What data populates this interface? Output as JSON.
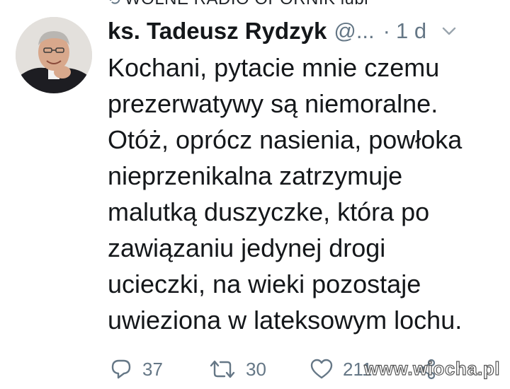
{
  "retweet_context": {
    "text": "WOLNE RADIO OPORNIK lubi"
  },
  "tweet": {
    "display_name": "ks. Tadeusz Rydzyk",
    "handle": "@...",
    "separator": "·",
    "time": "1 d",
    "lines": [
      "Kochani, pytacie mnie czemu",
      "prezerwatywy są niemoralne.",
      "Otóż, oprócz nasienia, powłoka",
      "nieprzenikalna zatrzymuje",
      "malutką duszyczke, która po",
      "zawiązaniu jedynej drogi",
      "ucieczki, na wieki pozostaje",
      "uwieziona w lateksowym lochu."
    ]
  },
  "actions": {
    "reply_count": "37",
    "retweet_count": "30",
    "like_count": "211"
  },
  "icons": {
    "reply": "reply-icon",
    "retweet": "retweet-icon",
    "like": "heart-icon",
    "share": "share-icon",
    "menu": "chevron-down-icon"
  },
  "watermark": {
    "text": "www.wiocha.pl"
  },
  "colors": {
    "text_primary": "#14171a",
    "text_secondary": "#657786",
    "background": "#ffffff"
  }
}
